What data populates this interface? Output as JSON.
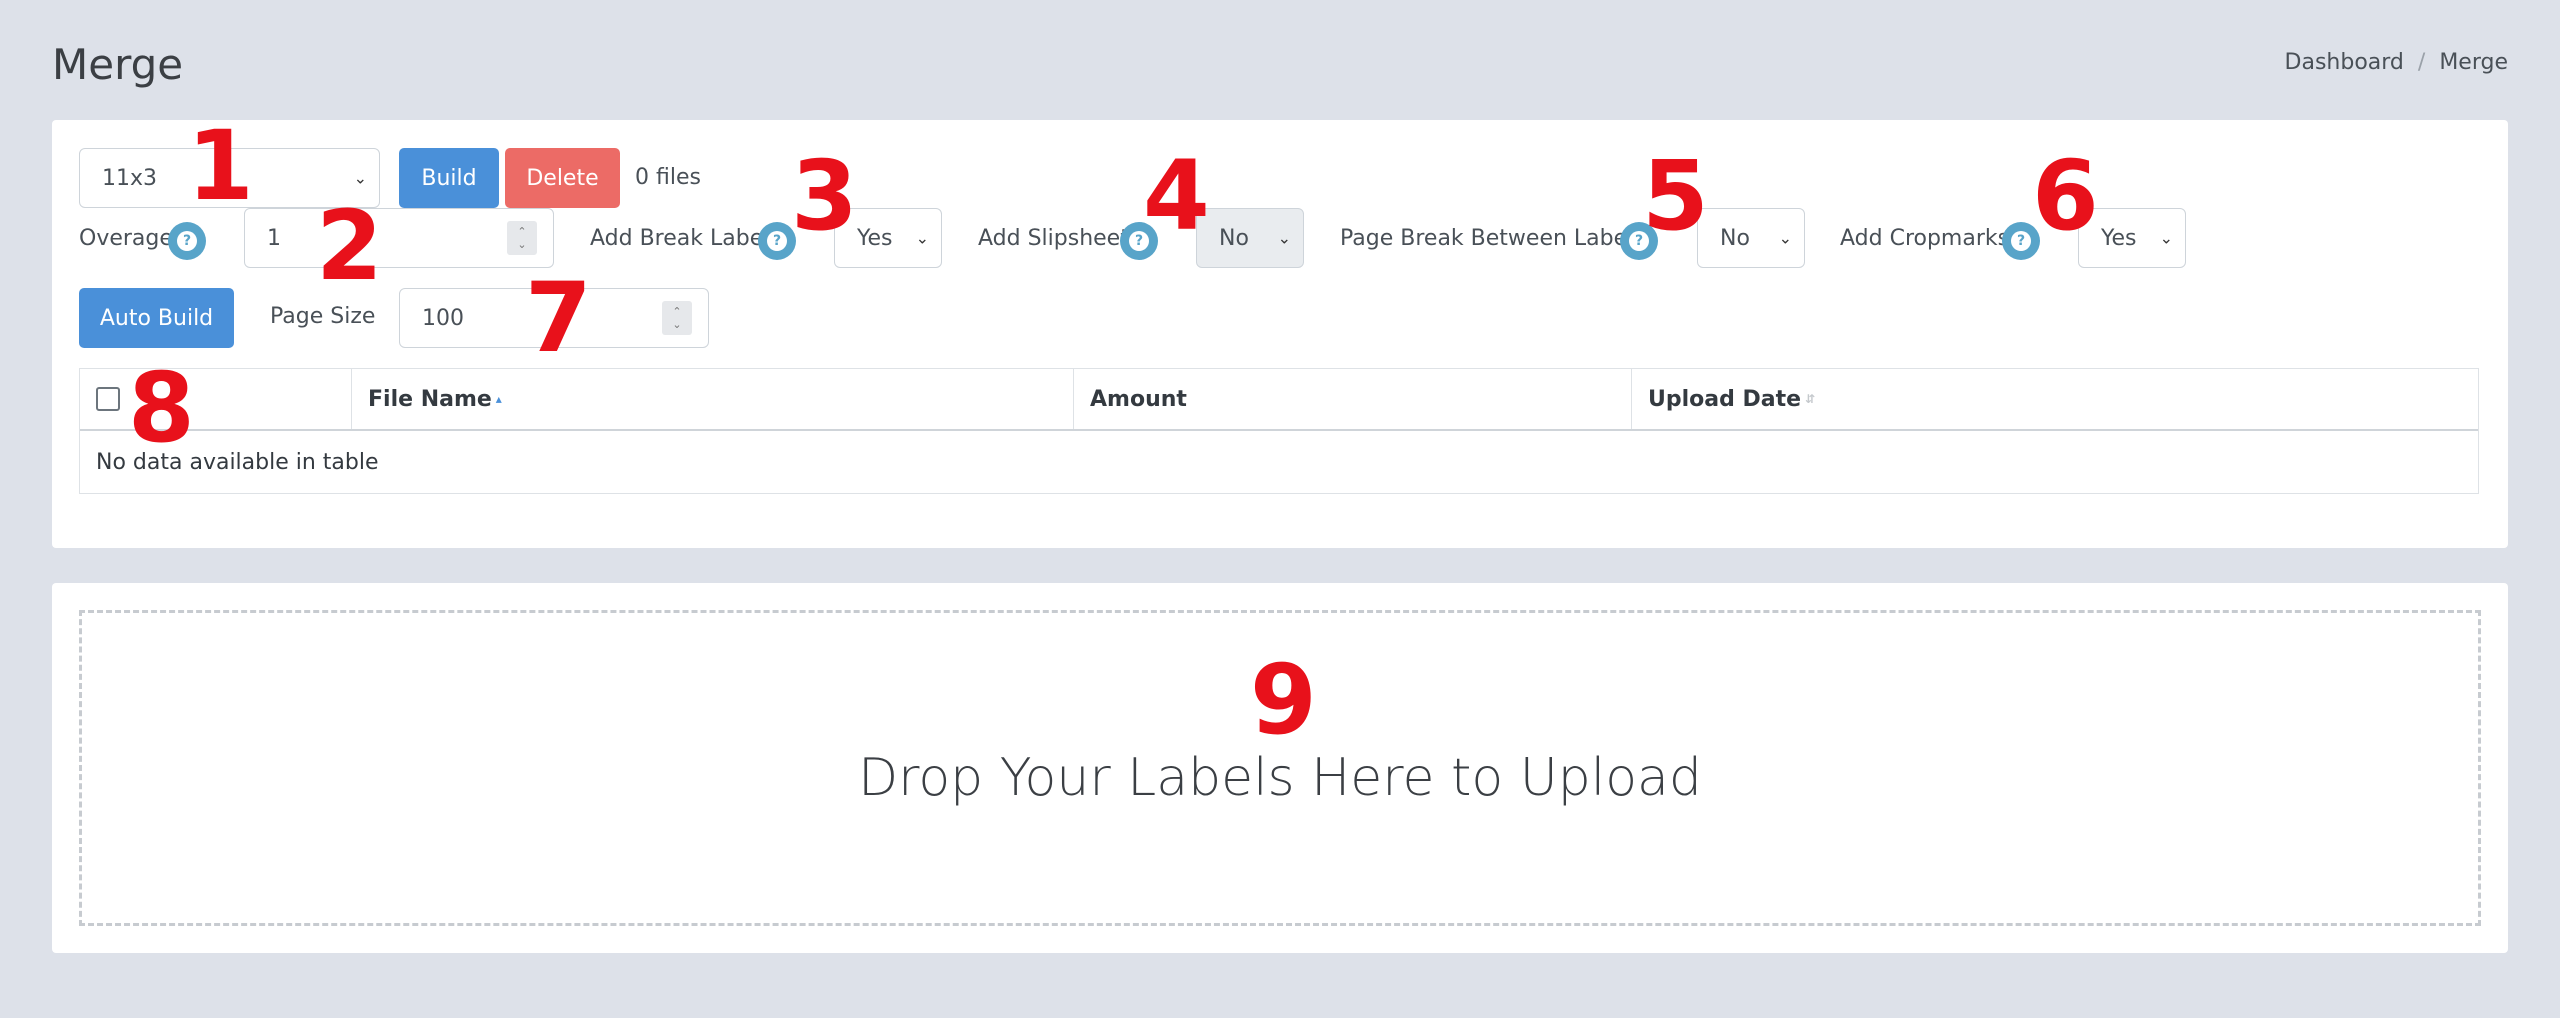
{
  "header": {
    "title": "Merge",
    "breadcrumb": [
      "Dashboard",
      "/",
      "Merge"
    ]
  },
  "toolbar": {
    "template_select": "11x3",
    "build_label": "Build",
    "delete_label": "Delete",
    "file_count": "0 files"
  },
  "options": {
    "overage_label": "Overage",
    "overage_value": "1",
    "break_label": "Add Break Label",
    "break_value": "Yes",
    "slipsheet_label": "Add Slipsheet",
    "slipsheet_value": "No",
    "page_break_label": "Page Break Between Labels",
    "page_break_value": "No",
    "cropmarks_label": "Add Cropmarks",
    "cropmarks_value": "Yes",
    "help_glyph": "?"
  },
  "autobuild": {
    "button_label": "Auto Build",
    "page_size_label": "Page Size",
    "page_size_value": "100"
  },
  "table": {
    "columns": [
      "",
      "File Name",
      "Amount",
      "Upload Date"
    ],
    "empty_message": "No data available in table"
  },
  "dropzone": {
    "text": "Drop Your Labels Here to Upload"
  },
  "annotations": [
    "1",
    "2",
    "3",
    "4",
    "5",
    "6",
    "7",
    "8",
    "9"
  ],
  "colors": {
    "primary": "#4a90d9",
    "danger": "#ec6b66",
    "help": "#58a4c9",
    "annotation": "#e8111b",
    "background": "#dde1e9"
  }
}
